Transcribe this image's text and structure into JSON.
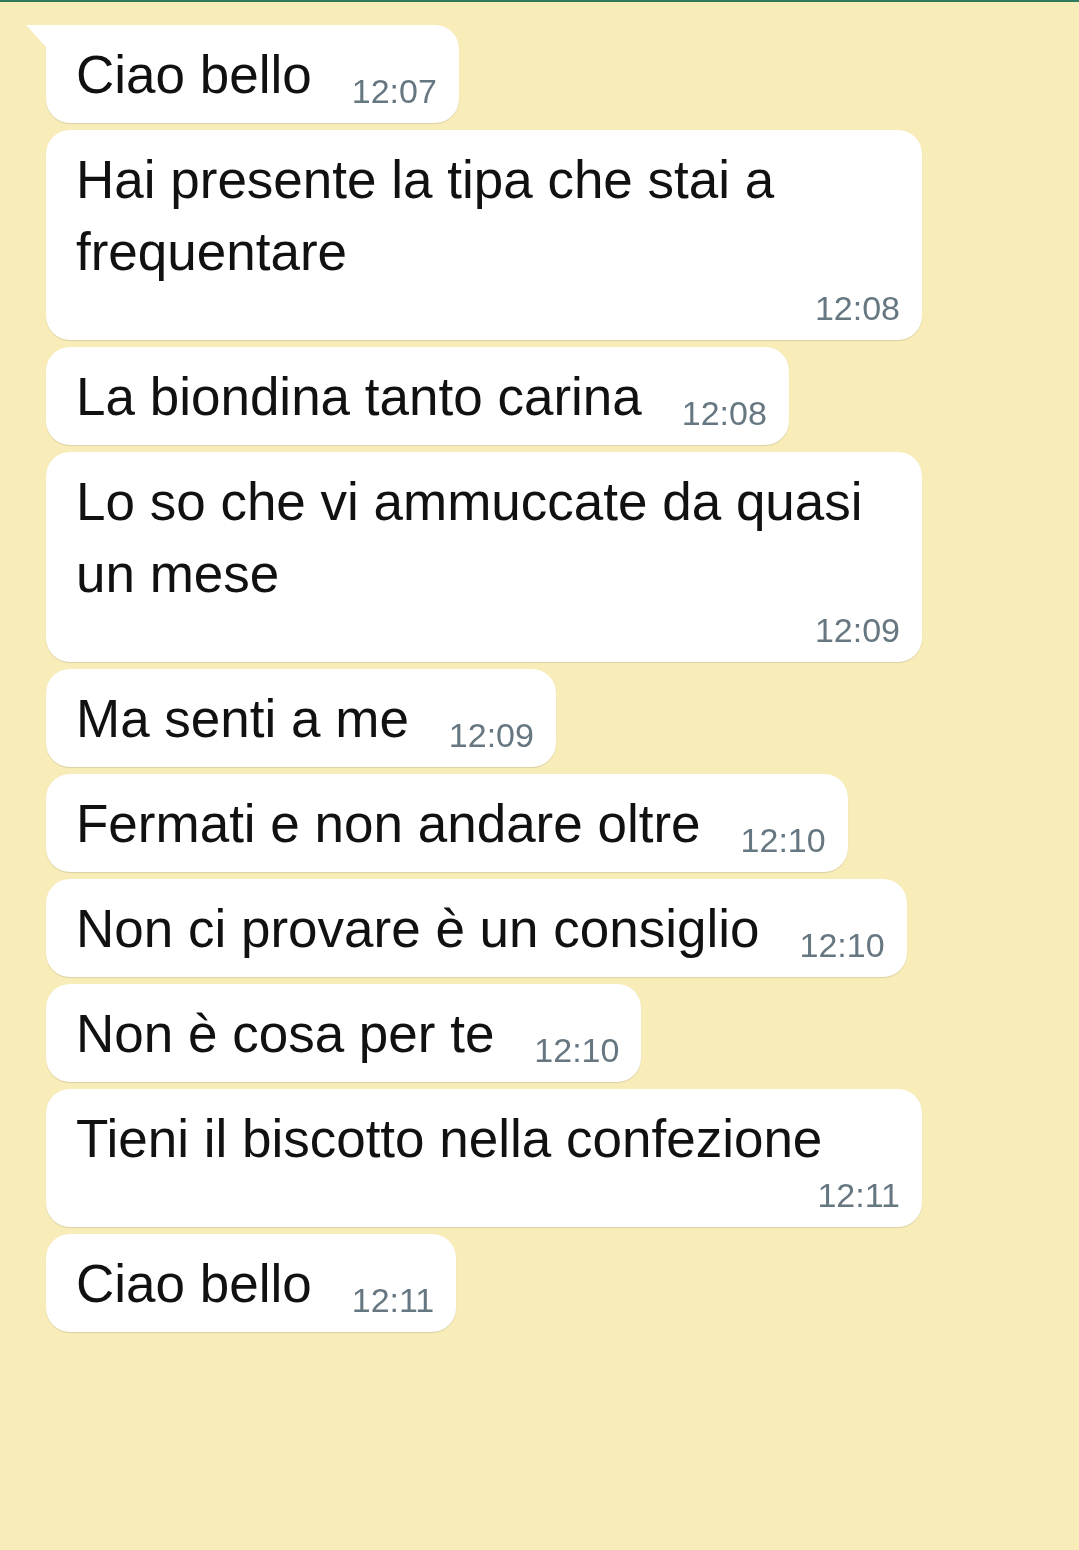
{
  "messages": [
    {
      "text": "Ciao bello",
      "time": "12:07",
      "tail": true
    },
    {
      "text": "Hai presente la tipa che stai a frequentare",
      "time": "12:08",
      "tail": false
    },
    {
      "text": "La biondina tanto carina",
      "time": "12:08",
      "tail": false
    },
    {
      "text": "Lo so che vi ammuccate da quasi un mese",
      "time": "12:09",
      "tail": false
    },
    {
      "text": "Ma senti a me",
      "time": "12:09",
      "tail": false
    },
    {
      "text": "Fermati e non andare oltre",
      "time": "12:10",
      "tail": false
    },
    {
      "text": "Non ci provare è un consiglio",
      "time": "12:10",
      "tail": false
    },
    {
      "text": "Non è cosa per te",
      "time": "12:10",
      "tail": false
    },
    {
      "text": "Tieni il biscotto nella confezione",
      "time": "12:11",
      "tail": false
    },
    {
      "text": "Ciao bello",
      "time": "12:11",
      "tail": false
    }
  ]
}
